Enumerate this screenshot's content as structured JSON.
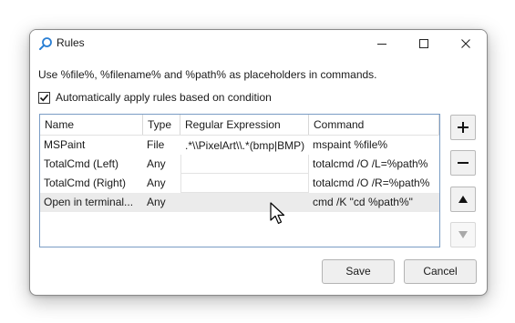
{
  "window": {
    "title": "Rules"
  },
  "hint_text": "Use %file%, %filename% and %path% as placeholders in commands.",
  "auto_apply": {
    "label": "Automatically apply rules based on condition",
    "checked": true
  },
  "table": {
    "columns": [
      "Name",
      "Type",
      "Regular Expression",
      "Command"
    ],
    "rows": [
      {
        "name": "MSPaint",
        "type": "File",
        "regex": ".*\\\\PixelArt\\\\.*(bmp|BMP)",
        "command": "mspaint %file%"
      },
      {
        "name": "TotalCmd (Left)",
        "type": "Any",
        "regex": "",
        "command": "totalcmd /O /L=%path%"
      },
      {
        "name": "TotalCmd (Right)",
        "type": "Any",
        "regex": "",
        "command": "totalcmd /O /R=%path%"
      },
      {
        "name": "Open in terminal...",
        "type": "Any",
        "regex": "",
        "command": "cmd /K \"cd %path%\""
      }
    ],
    "selected_row": 3
  },
  "buttons": {
    "save": "Save",
    "cancel": "Cancel"
  },
  "icons": {
    "app": "search-icon",
    "add": "plus-icon",
    "remove": "minus-icon",
    "move_up": "triangle-up-icon",
    "move_down": "triangle-down-icon"
  },
  "colors": {
    "accent": "#0078d4",
    "selected_row": "#ebebeb",
    "table_border": "#7a9cc4"
  }
}
